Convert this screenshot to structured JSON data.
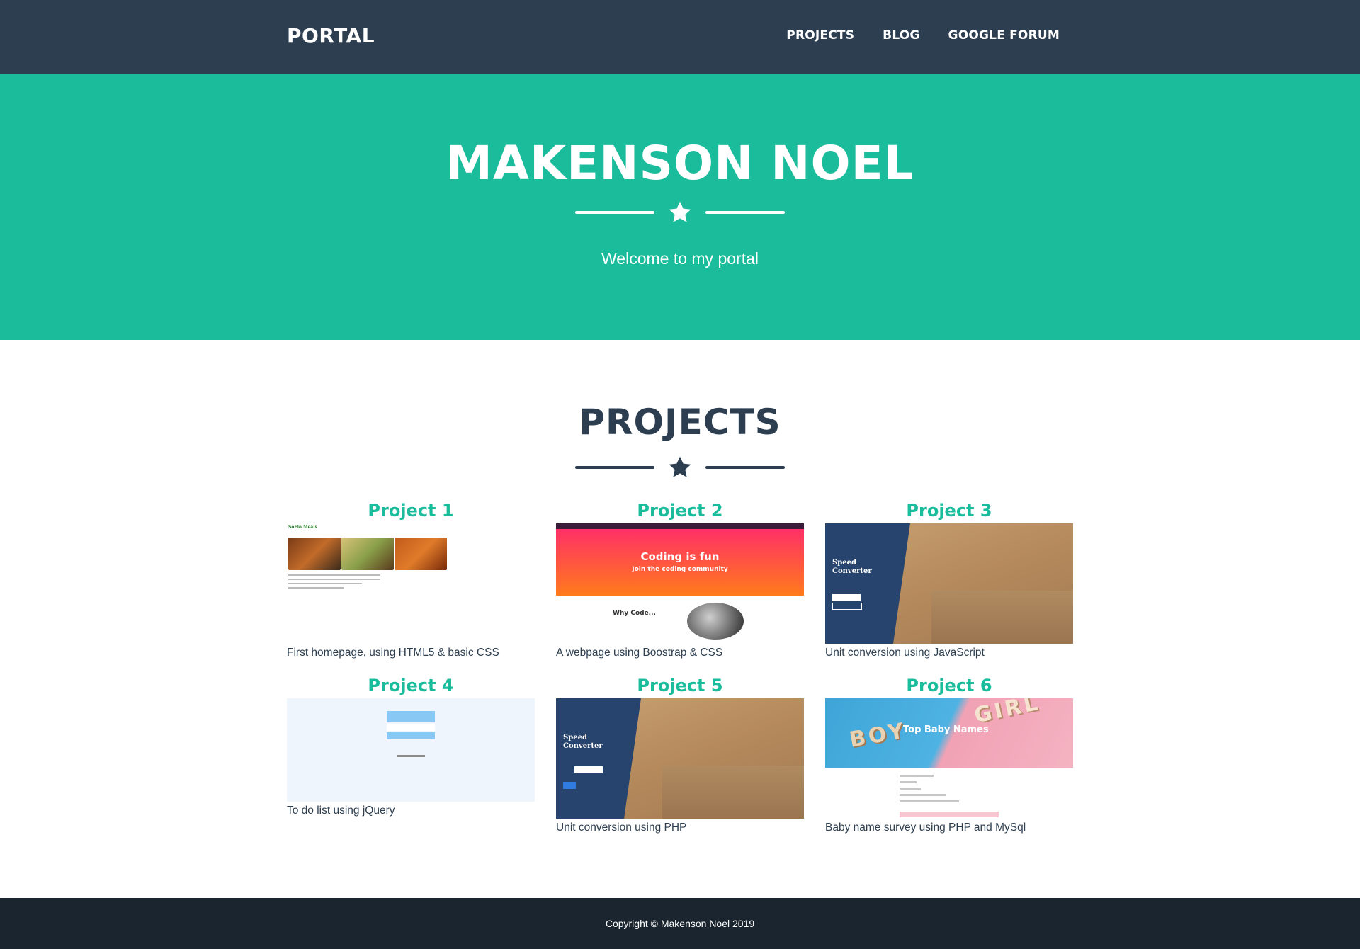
{
  "navbar": {
    "brand": "PORTAL",
    "links": [
      "PROJECTS",
      "BLOG",
      "GOOGLE FORUM"
    ]
  },
  "masthead": {
    "title": "MAKENSON NOEL",
    "subtitle": "Welcome to my portal",
    "icon": "star-icon"
  },
  "projects": {
    "title": "PROJECTS",
    "icon": "star-icon",
    "items": [
      {
        "title": "Project 1",
        "description": "First homepage, using HTML5 & basic CSS",
        "thumbnail": {
          "header": "SoFlo Meals"
        }
      },
      {
        "title": "Project 2",
        "description": "A webpage using Boostrap & CSS",
        "thumbnail": {
          "headline": "Coding is fun",
          "subheadline": "Join the coding community",
          "section": "Why Code..."
        }
      },
      {
        "title": "Project 3",
        "description": "Unit conversion using JavaScript",
        "thumbnail": {
          "label": "Speed Converter"
        }
      },
      {
        "title": "Project 4",
        "description": "To do list using jQuery",
        "thumbnail": {}
      },
      {
        "title": "Project 5",
        "description": "Unit conversion using PHP",
        "thumbnail": {
          "label": "Speed Converter"
        }
      },
      {
        "title": "Project 6",
        "description": "Baby name survey using PHP and MySql",
        "thumbnail": {
          "left_word": "BOY",
          "right_word": "GIRL",
          "headline": "Top Baby Names"
        }
      }
    ]
  },
  "footer": {
    "copyright": "Copyright © Makenson Noel 2019"
  },
  "colors": {
    "navbar": "#2c3e50",
    "accent": "#1abc9c",
    "footer": "#1a252f",
    "text": "#2c3e50"
  }
}
